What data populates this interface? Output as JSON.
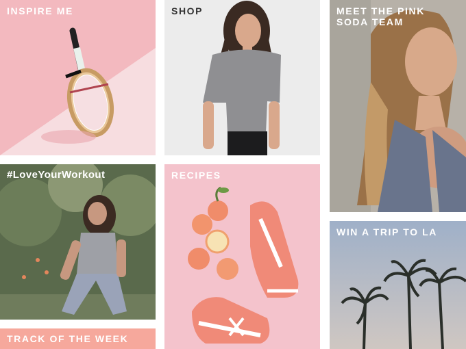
{
  "tiles": {
    "inspire": {
      "label": "INSPIRE ME",
      "bg": "#f2b8bd"
    },
    "shop": {
      "label": "SHOP",
      "bg": "#e9e9e9"
    },
    "team": {
      "label": "MEET THE PINK\nSODA TEAM",
      "line1": "MEET THE PINK",
      "line2": "SODA TEAM",
      "bg": "#b8b3aa"
    },
    "workout": {
      "label": "#LoveYourWorkout",
      "bg": "#5f6d4e"
    },
    "recipes": {
      "label": "RECIPES",
      "bg": "#f4c2cc"
    },
    "trip": {
      "label": "WIN A TRIP TO LA",
      "bg": "#9fb0c6"
    },
    "track": {
      "label": "TRACK OF THE WEEK",
      "bg": "#f6a89c"
    }
  },
  "icons": {
    "racket": "tennis-racket-icon",
    "sneaker": "sneaker-icon",
    "palm": "palm-tree-icon",
    "peach": "peach-icon"
  }
}
